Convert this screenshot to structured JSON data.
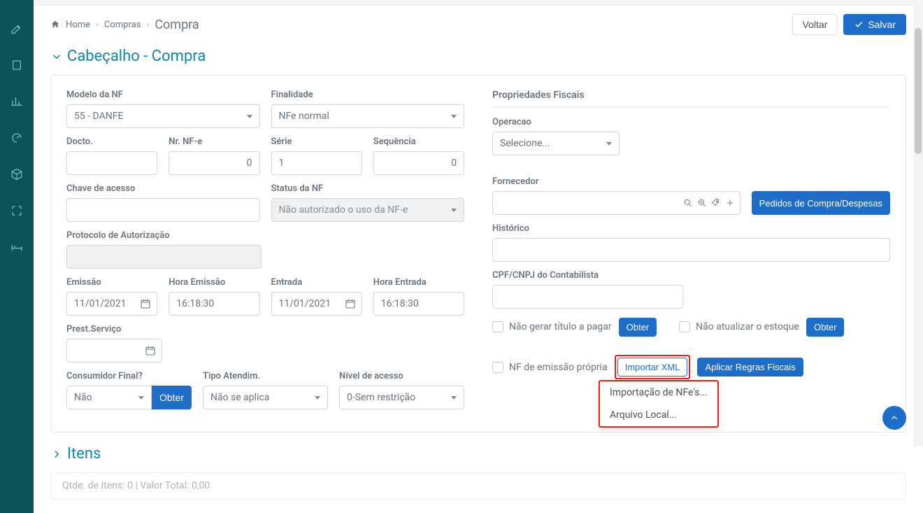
{
  "header": {
    "breadcrumb": {
      "home": "Home",
      "level1": "Compras",
      "current": "Compra"
    },
    "actions": {
      "voltar": "Voltar",
      "salvar": "Salvar"
    }
  },
  "section": {
    "title": "Cabeçalho - Compra"
  },
  "left": {
    "modelo_nf": {
      "label": "Modelo da NF",
      "value": "55 - DANFE"
    },
    "finalidade": {
      "label": "Finalidade",
      "value": "NFe normal"
    },
    "docto": {
      "label": "Docto.",
      "value": ""
    },
    "nr_nfe": {
      "label": "Nr. NF-e",
      "value": "0"
    },
    "serie": {
      "label": "Série",
      "value": "1"
    },
    "sequencia": {
      "label": "Sequência",
      "value": "0"
    },
    "chave": {
      "label": "Chave de acesso",
      "value": ""
    },
    "status_nf": {
      "label": "Status da NF",
      "value": "Não autorizado o uso da NF-e"
    },
    "protocolo": {
      "label": "Protocolo de Autorização",
      "value": ""
    },
    "emissao": {
      "label": "Emissão",
      "value": "11/01/2021"
    },
    "hora_emissao": {
      "label": "Hora Emissão",
      "value": "16:18:30"
    },
    "entrada": {
      "label": "Entrada",
      "value": "11/01/2021"
    },
    "hora_entrada": {
      "label": "Hora Entrada",
      "value": "16:18:30"
    },
    "prest_servico": {
      "label": "Prest.Serviço",
      "value": ""
    },
    "consumidor_final": {
      "label": "Consumidor Final?",
      "value": "Não",
      "obter": "Obter"
    },
    "tipo_atendim": {
      "label": "Tipo Atendim.",
      "value": "Não se aplica"
    },
    "nivel_acesso": {
      "label": "Nível de acesso",
      "value": "0-Sem restrição"
    }
  },
  "right": {
    "prop_fiscais": {
      "title": "Propriedades Fiscais"
    },
    "operacao": {
      "label": "Operacao",
      "value": "Selecione..."
    },
    "fornecedor": {
      "label": "Fornecedor",
      "value": "",
      "btn": "Pedidos de Compra/Despesas"
    },
    "historico": {
      "label": "Histórico",
      "value": ""
    },
    "cpf_cnpj": {
      "label": "CPF/CNPJ do Contabilista",
      "value": ""
    },
    "nao_gerar_titulo": "Não gerar título a pagar",
    "obter1": "Obter",
    "nao_atualizar_estoque": "Não atualizar o estoque",
    "obter2": "Obter",
    "nf_emissao_propria": "NF de emissão própria",
    "importar_xml": "Importar XML",
    "aplicar_regras": "Aplicar Regras Fiscais",
    "dropdown": {
      "item1": "Importação de NFe's...",
      "item2": "Arquivo Local..."
    }
  },
  "itens": {
    "title": "Itens",
    "footer": "Qtde. de Itens: 0 | Valor Total: 0,00"
  }
}
